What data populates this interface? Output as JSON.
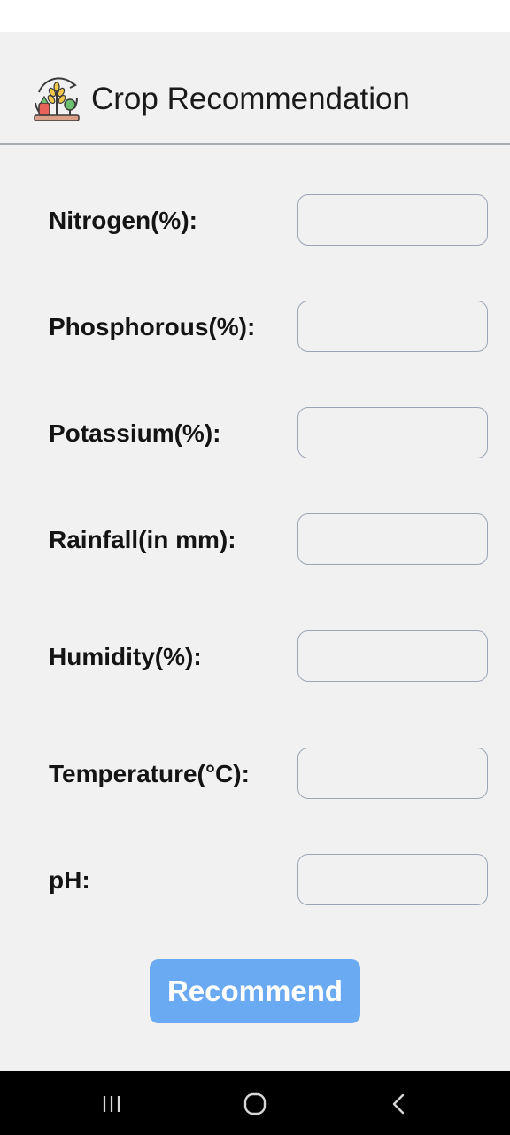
{
  "header": {
    "title": "Crop Recommendation",
    "logo_icon": "crop-plant-icon"
  },
  "form": {
    "fields": [
      {
        "label": "Nitrogen(%):",
        "value": ""
      },
      {
        "label": "Phosphorous(%):",
        "value": ""
      },
      {
        "label": "Potassium(%):",
        "value": ""
      },
      {
        "label": "Rainfall(in mm):",
        "value": ""
      },
      {
        "label": "Humidity(%):",
        "value": ""
      },
      {
        "label": "Temperature(°C):",
        "value": ""
      },
      {
        "label": "pH:",
        "value": ""
      }
    ],
    "submit_label": "Recommend"
  },
  "navigation_bar": {
    "buttons": [
      "recent-apps-icon",
      "home-icon",
      "back-icon"
    ]
  },
  "colors": {
    "background": "#f1f1f1",
    "button": "#6aaaf3",
    "input_border": "#9aa6b6",
    "divider": "#a6abb0"
  }
}
